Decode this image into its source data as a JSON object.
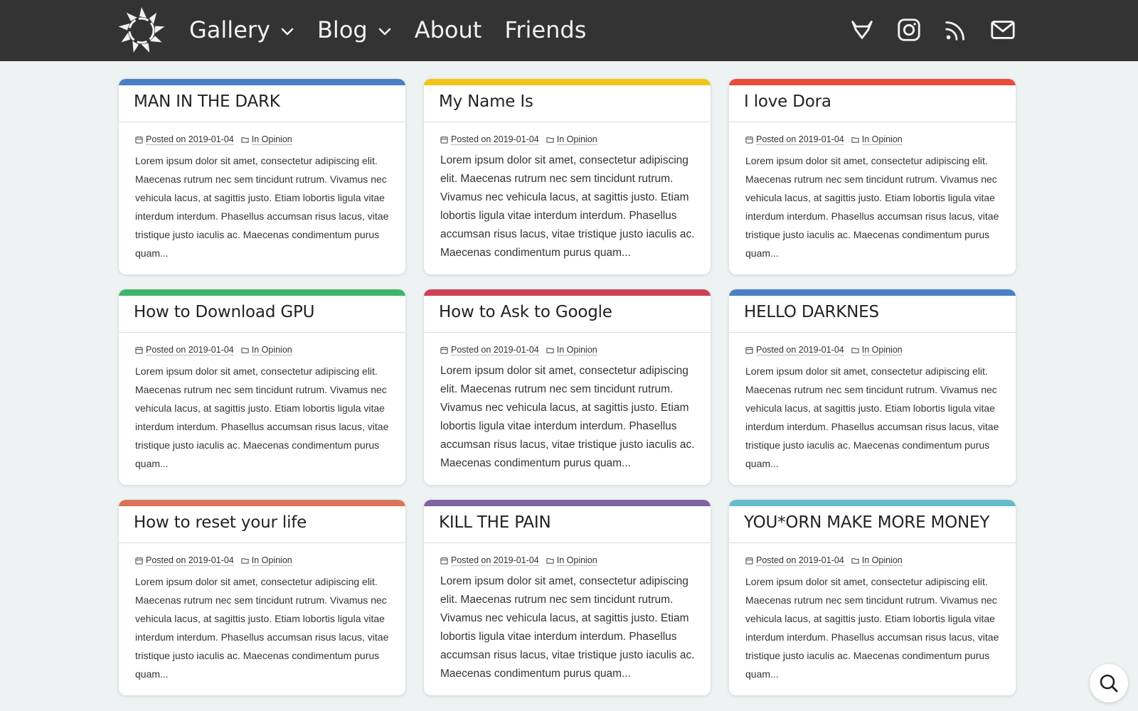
{
  "nav": {
    "logo_icon": "sunburst-logo-icon",
    "items": [
      {
        "label": "Gallery",
        "dropdown": true
      },
      {
        "label": "Blog",
        "dropdown": true
      },
      {
        "label": "About",
        "dropdown": false
      },
      {
        "label": "Friends",
        "dropdown": false
      }
    ],
    "social_icons": [
      "gitlab-icon",
      "instagram-icon",
      "rss-icon",
      "mail-icon"
    ]
  },
  "posts": [
    {
      "title": "MAN IN THE DARK",
      "accent": "#4a7fc6",
      "posted_label": "Posted on",
      "date": "2019-01-04",
      "in_label": "In",
      "category": "Opinion",
      "excerpt": "Lorem ipsum dolor sit amet, consectetur adipiscing elit. Maecenas rutrum nec sem tincidunt rutrum. Vivamus nec vehicula lacus, at sagittis justo. Etiam lobortis ligula vitae interdum interdum. Phasellus accumsan risus lacus, vitae tristique justo iaculis ac. Maecenas condimentum purus quam..."
    },
    {
      "title": "My Name Is",
      "accent": "#f2c417",
      "posted_label": "Posted on",
      "date": "2019-01-04",
      "in_label": "In",
      "category": "Opinion",
      "excerpt": "Lorem ipsum dolor sit amet, consectetur adipiscing elit. Maecenas rutrum nec sem tincidunt rutrum. Vivamus nec vehicula lacus, at sagittis justo. Etiam lobortis ligula vitae interdum interdum. Phasellus accumsan risus lacus, vitae tristique justo iaculis ac. Maecenas condimentum purus quam..."
    },
    {
      "title": "I love Dora",
      "accent": "#e84c3d",
      "posted_label": "Posted on",
      "date": "2019-01-04",
      "in_label": "In",
      "category": "Opinion",
      "excerpt": "Lorem ipsum dolor sit amet, consectetur adipiscing elit. Maecenas rutrum nec sem tincidunt rutrum. Vivamus nec vehicula lacus, at sagittis justo. Etiam lobortis ligula vitae interdum interdum. Phasellus accumsan risus lacus, vitae tristique justo iaculis ac. Maecenas condimentum purus quam..."
    },
    {
      "title": "How to Download GPU",
      "accent": "#3fb56a",
      "posted_label": "Posted on",
      "date": "2019-01-04",
      "in_label": "In",
      "category": "Opinion",
      "excerpt": "Lorem ipsum dolor sit amet, consectetur adipiscing elit. Maecenas rutrum nec sem tincidunt rutrum. Vivamus nec vehicula lacus, at sagittis justo. Etiam lobortis ligula vitae interdum interdum. Phasellus accumsan risus lacus, vitae tristique justo iaculis ac. Maecenas condimentum purus quam..."
    },
    {
      "title": "How to Ask to Google",
      "accent": "#cf4157",
      "posted_label": "Posted on",
      "date": "2019-01-04",
      "in_label": "In",
      "category": "Opinion",
      "excerpt": "Lorem ipsum dolor sit amet, consectetur adipiscing elit. Maecenas rutrum nec sem tincidunt rutrum. Vivamus nec vehicula lacus, at sagittis justo. Etiam lobortis ligula vitae interdum interdum. Phasellus accumsan risus lacus, vitae tristique justo iaculis ac. Maecenas condimentum purus quam..."
    },
    {
      "title": "HELLO DARKNES",
      "accent": "#4a7fc6",
      "posted_label": "Posted on",
      "date": "2019-01-04",
      "in_label": "In",
      "category": "Opinion",
      "excerpt": "Lorem ipsum dolor sit amet, consectetur adipiscing elit. Maecenas rutrum nec sem tincidunt rutrum. Vivamus nec vehicula lacus, at sagittis justo. Etiam lobortis ligula vitae interdum interdum. Phasellus accumsan risus lacus, vitae tristique justo iaculis ac. Maecenas condimentum purus quam..."
    },
    {
      "title": "How to reset your life",
      "accent": "#d9735a",
      "posted_label": "Posted on",
      "date": "2019-01-04",
      "in_label": "In",
      "category": "Opinion",
      "excerpt": "Lorem ipsum dolor sit amet, consectetur adipiscing elit. Maecenas rutrum nec sem tincidunt rutrum. Vivamus nec vehicula lacus, at sagittis justo. Etiam lobortis ligula vitae interdum interdum. Phasellus accumsan risus lacus, vitae tristique justo iaculis ac. Maecenas condimentum purus quam..."
    },
    {
      "title": "KILL THE PAIN",
      "accent": "#7f63a3",
      "posted_label": "Posted on",
      "date": "2019-01-04",
      "in_label": "In",
      "category": "Opinion",
      "excerpt": "Lorem ipsum dolor sit amet, consectetur adipiscing elit. Maecenas rutrum nec sem tincidunt rutrum. Vivamus nec vehicula lacus, at sagittis justo. Etiam lobortis ligula vitae interdum interdum. Phasellus accumsan risus lacus, vitae tristique justo iaculis ac. Maecenas condimentum purus quam..."
    },
    {
      "title": "YOU*ORN MAKE MORE MONEY",
      "accent": "#65bccb",
      "posted_label": "Posted on",
      "date": "2019-01-04",
      "in_label": "In",
      "category": "Opinion",
      "excerpt": "Lorem ipsum dolor sit amet, consectetur adipiscing elit. Maecenas rutrum nec sem tincidunt rutrum. Vivamus nec vehicula lacus, at sagittis justo. Etiam lobortis ligula vitae interdum interdum. Phasellus accumsan risus lacus, vitae tristique justo iaculis ac. Maecenas condimentum purus quam..."
    }
  ],
  "search_fab": {
    "icon": "search-icon"
  }
}
